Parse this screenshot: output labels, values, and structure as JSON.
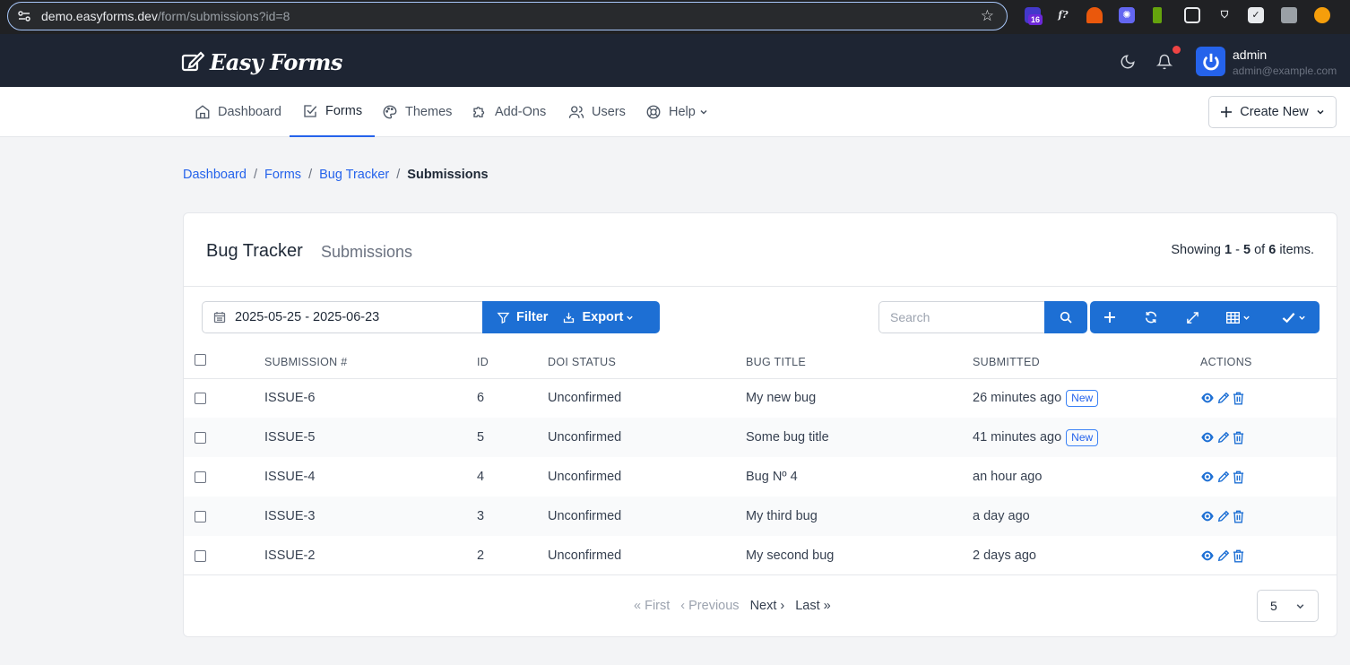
{
  "browser": {
    "url_host": "demo.easyforms.dev",
    "url_path": "/form/submissions?id=8",
    "extension_badge": "16"
  },
  "header": {
    "logo_text": "Easy Forms",
    "user_name": "admin",
    "user_email": "admin@example.com"
  },
  "nav": {
    "items": [
      {
        "label": "Dashboard",
        "icon": "home-icon"
      },
      {
        "label": "Forms",
        "icon": "checkbox-edit-icon",
        "active": true
      },
      {
        "label": "Themes",
        "icon": "palette-icon"
      },
      {
        "label": "Add-Ons",
        "icon": "puzzle-icon"
      },
      {
        "label": "Users",
        "icon": "users-icon"
      },
      {
        "label": "Help",
        "icon": "lifebuoy-icon"
      }
    ],
    "create_new": "Create New"
  },
  "breadcrumb": {
    "items": [
      "Dashboard",
      "Forms",
      "Bug Tracker"
    ],
    "current": "Submissions"
  },
  "card": {
    "title": "Bug Tracker",
    "subtitle": "Submissions",
    "summary": {
      "prefix": "Showing",
      "from": "1",
      "dash": "-",
      "to": "5",
      "of": "of",
      "total": "6",
      "suffix": "items."
    }
  },
  "toolbar": {
    "date_range": "2025-05-25 - 2025-06-23",
    "filter_label": "Filter",
    "export_label": "Export",
    "search_placeholder": "Search"
  },
  "table": {
    "columns": [
      "SUBMISSION #",
      "ID",
      "DOI STATUS",
      "BUG TITLE",
      "SUBMITTED",
      "ACTIONS"
    ],
    "rows": [
      {
        "submission": "ISSUE-6",
        "id": "6",
        "doi": "Unconfirmed",
        "title": "My new bug",
        "submitted": "26 minutes ago",
        "badge": "New"
      },
      {
        "submission": "ISSUE-5",
        "id": "5",
        "doi": "Unconfirmed",
        "title": "Some bug title",
        "submitted": "41 minutes ago",
        "badge": "New"
      },
      {
        "submission": "ISSUE-4",
        "id": "4",
        "doi": "Unconfirmed",
        "title": "Bug Nº 4",
        "submitted": "an hour ago",
        "badge": ""
      },
      {
        "submission": "ISSUE-3",
        "id": "3",
        "doi": "Unconfirmed",
        "title": "My third bug",
        "submitted": "a day ago",
        "badge": ""
      },
      {
        "submission": "ISSUE-2",
        "id": "2",
        "doi": "Unconfirmed",
        "title": "My second bug",
        "submitted": "2 days ago",
        "badge": ""
      }
    ]
  },
  "pagination": {
    "first": "« First",
    "previous": "‹ Previous",
    "next": "Next ›",
    "last": "Last »",
    "per_page": "5"
  },
  "colors": {
    "primary": "#1d6fd4",
    "header_bg": "#1e2533",
    "link": "#2563eb"
  }
}
